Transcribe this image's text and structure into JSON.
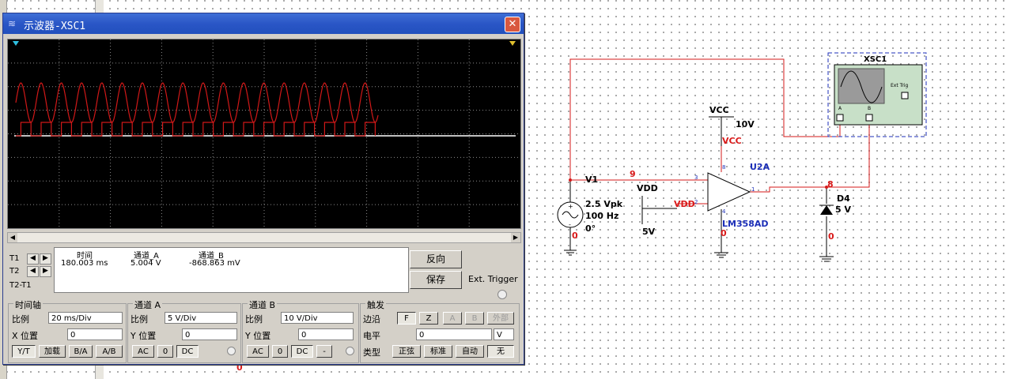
{
  "window": {
    "title": "示波器-XSC1",
    "close_glyph": "✕"
  },
  "readout": {
    "headers": {
      "time": "时间",
      "chA": "通道_A",
      "chB": "通道_B"
    },
    "t1_label": "T1",
    "t2_label": "T2",
    "t2t1_label": "T2-T1",
    "values": {
      "time": "180.003 ms",
      "chA": "5.004 V",
      "chB": "-868.863 mV"
    },
    "reverse_button": "反向",
    "save_button": "保存",
    "ext_trigger": "Ext. Trigger"
  },
  "timebase": {
    "group": "时间轴",
    "scale_label": "比例",
    "scale": "20 ms/Div",
    "xpos_label": "X 位置",
    "xpos": "0",
    "modes": [
      "Y/T",
      "加载",
      "B/A",
      "A/B"
    ]
  },
  "channel_a": {
    "group": "通道 A",
    "scale_label": "比例",
    "scale": "5  V/Div",
    "ypos_label": "Y 位置",
    "ypos": "0",
    "coupling": [
      "AC",
      "0",
      "DC"
    ]
  },
  "channel_b": {
    "group": "通道 B",
    "scale_label": "比例",
    "scale": "10  V/Div",
    "ypos_label": "Y 位置",
    "ypos": "0",
    "coupling": [
      "AC",
      "0",
      "DC",
      "-"
    ]
  },
  "trigger": {
    "group": "触发",
    "edge_label": "边沿",
    "level_label": "电平",
    "type_label": "类型",
    "edge_buttons": [
      "F",
      "Z",
      "A",
      "B",
      "外部"
    ],
    "level": "0",
    "level_unit": "V",
    "type_buttons": [
      "正弦",
      "标准",
      "自动",
      "无"
    ]
  },
  "schematic": {
    "v1": "V1",
    "v1_amp": "2.5 Vpk",
    "v1_freq": "100 Hz",
    "v1_phase": "0°",
    "node9": "9",
    "node8": "8",
    "node0": "0",
    "vcc": "VCC",
    "vcc_val": "10V",
    "vcc_pin": "VCC",
    "vdd": "VDD",
    "vdd_val": "5V",
    "vdd_pin": "VDD",
    "u2a": "U2A",
    "opamp": "LM358AD",
    "d4": "D4",
    "d4_val": "5 V",
    "xsc1": "XSC1",
    "ext_trig": "Ext Trig",
    "pin3": "3",
    "pin2": "2",
    "pin1": "1",
    "pin8": "8",
    "pin4": "4",
    "chA_pin": "A",
    "chB_pin": "B"
  },
  "colors": {
    "trace_a": "#d01818",
    "trace_b": "#ffffff",
    "wire": "#d41a1a",
    "titlebar": "#2a56c6"
  },
  "icons": {
    "window": "oscilloscope-icon",
    "close": "close-icon"
  }
}
